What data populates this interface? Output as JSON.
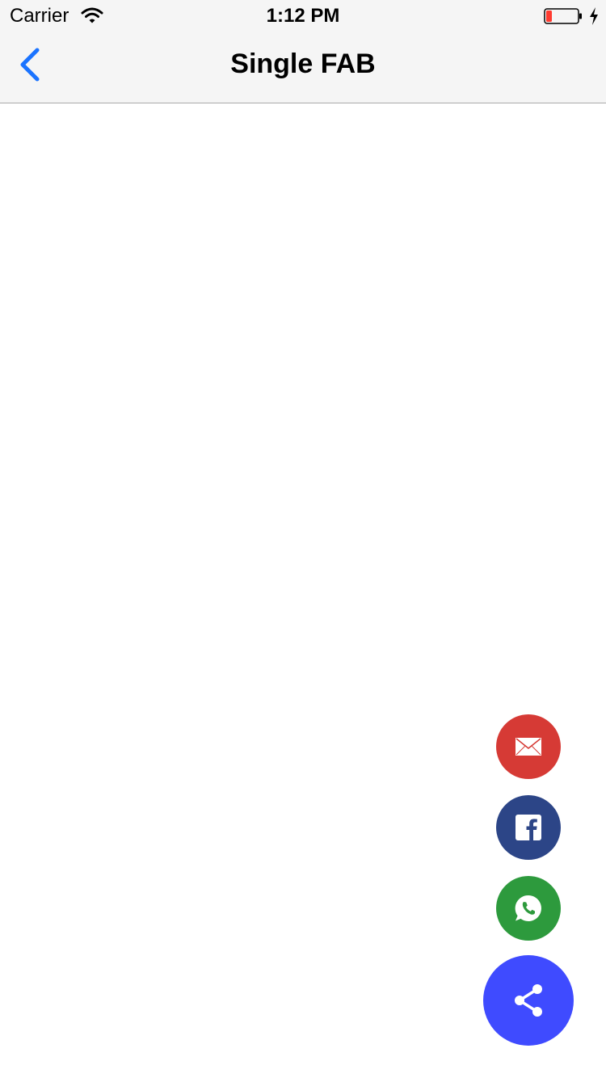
{
  "status_bar": {
    "carrier": "Carrier",
    "time": "1:12 PM",
    "wifi_icon": "wifi-icon",
    "battery_icon": "battery-low-icon",
    "charging_icon": "charging-bolt-icon",
    "battery_color": "#ff3b30"
  },
  "nav_bar": {
    "title": "Single FAB",
    "back_icon": "chevron-left-icon",
    "accent_color": "#1a73ff"
  },
  "fab": {
    "main": {
      "icon": "share-icon",
      "color": "#3f4bff"
    },
    "actions": [
      {
        "name": "email",
        "icon": "mail-icon",
        "color": "#d63a35"
      },
      {
        "name": "facebook",
        "icon": "facebook-icon",
        "color": "#2c4587"
      },
      {
        "name": "whatsapp",
        "icon": "whatsapp-icon",
        "color": "#2d9a3d"
      }
    ]
  }
}
